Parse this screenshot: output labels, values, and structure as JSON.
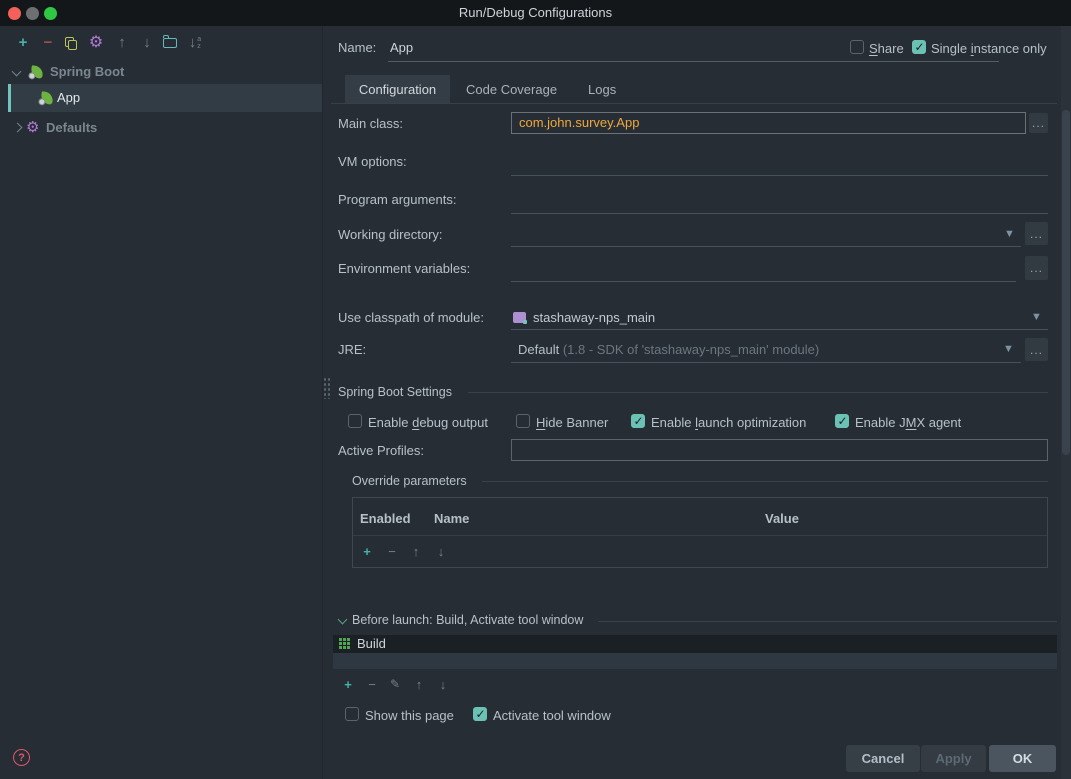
{
  "window": {
    "title": "Run/Debug Configurations"
  },
  "colors": {
    "accent_teal": "#6cc1b5",
    "main_class_value": "#efa73d",
    "spring_green": "#6db33f",
    "gear_purple": "#b07ad1",
    "help_red": "#e0566a"
  },
  "toolbar": {
    "icons": [
      "add",
      "remove",
      "copy",
      "edit-templates",
      "move-up",
      "move-down",
      "new-folder",
      "sort-configurations"
    ]
  },
  "tree": {
    "items": [
      {
        "label": "Spring Boot",
        "type": "group",
        "expanded": true
      },
      {
        "label": "App",
        "selected": true
      },
      {
        "label": "Defaults",
        "type": "group",
        "expanded": false
      }
    ]
  },
  "form": {
    "browse_label": "...",
    "name": {
      "label": "Name:",
      "value": "App"
    },
    "share": {
      "label": "_Share",
      "checked": false
    },
    "single_instance": {
      "label": "Single _instance only",
      "checked": true
    },
    "tabs": [
      {
        "label": "Configuration",
        "active": true
      },
      {
        "label": "Code Coverage",
        "active": false
      },
      {
        "label": "Logs",
        "active": false
      }
    ],
    "main_class": {
      "label": "Main class:",
      "value": "com.john.survey.App"
    },
    "vm_options": {
      "label": "VM options:",
      "value": ""
    },
    "program_arguments": {
      "label": "Program arguments:",
      "value": ""
    },
    "working_directory": {
      "label": "Working directory:",
      "value": ""
    },
    "environment_variables": {
      "label": "Environment variables:",
      "value": ""
    },
    "use_classpath": {
      "label": "Use classpath of module:",
      "value": "stashaway-nps_main"
    },
    "jre": {
      "label": "JRE:",
      "value": "Default",
      "hint": "(1.8 - SDK of 'stashaway-nps_main' module)"
    }
  },
  "spring_boot_settings": {
    "title": "Spring Boot Settings",
    "checkboxes": [
      {
        "label": "Enable _debug output",
        "checked": false
      },
      {
        "label": "_Hide Banner",
        "checked": false
      },
      {
        "label": "Enable _launch optimization",
        "checked": true
      },
      {
        "label": "Enable J_MX agent",
        "checked": true
      }
    ],
    "active_profiles": {
      "label": "Active Profiles:",
      "value": ""
    }
  },
  "override_parameters": {
    "title": "Override parameters",
    "columns": [
      "Enabled",
      "Name",
      "Value"
    ],
    "rows": []
  },
  "before_launch": {
    "title": "Before launch: Build, Activate tool window",
    "items": [
      {
        "label": "Build"
      }
    ],
    "show_this_page": {
      "label": "Show this page",
      "checked": false
    },
    "activate_tool_window": {
      "label": "Activate tool window",
      "checked": true
    }
  },
  "footer": {
    "cancel": "Cancel",
    "apply": "Apply",
    "ok": "OK"
  }
}
